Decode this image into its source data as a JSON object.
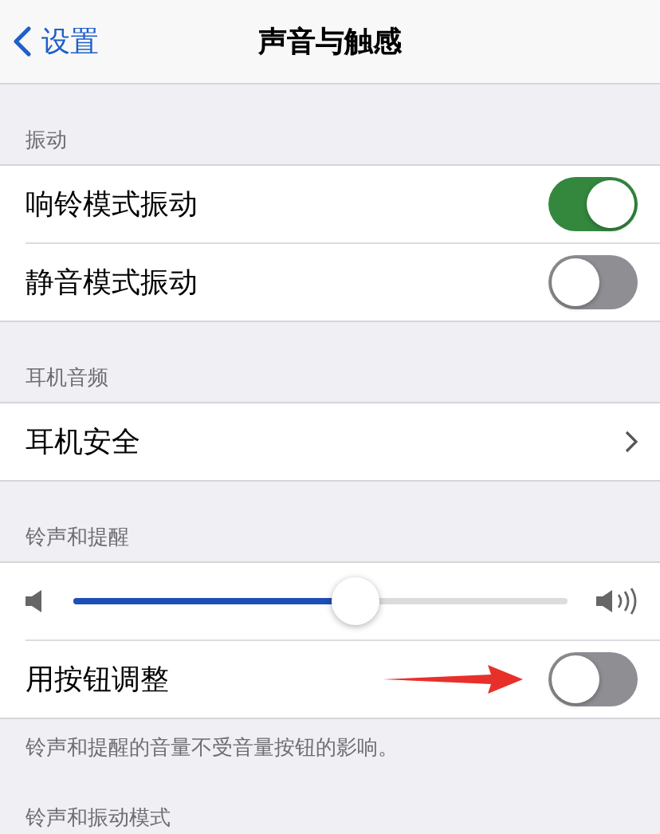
{
  "nav": {
    "back": "设置",
    "title": "声音与触感"
  },
  "sections": [
    {
      "header": "振动",
      "rows": [
        {
          "kind": "toggle",
          "label": "响铃模式振动",
          "on": true
        },
        {
          "kind": "toggle",
          "label": "静音模式振动",
          "on": false
        }
      ]
    },
    {
      "header": "耳机音频",
      "rows": [
        {
          "kind": "link",
          "label": "耳机安全"
        }
      ]
    },
    {
      "header": "铃声和提醒",
      "rows": [
        {
          "kind": "slider",
          "level": 0.57
        },
        {
          "kind": "toggle",
          "label": "用按钮调整",
          "on": false,
          "arrow": true
        }
      ],
      "footer": "铃声和提醒的音量不受音量按钮的影响。"
    },
    {
      "header": "铃声和振动模式"
    }
  ]
}
